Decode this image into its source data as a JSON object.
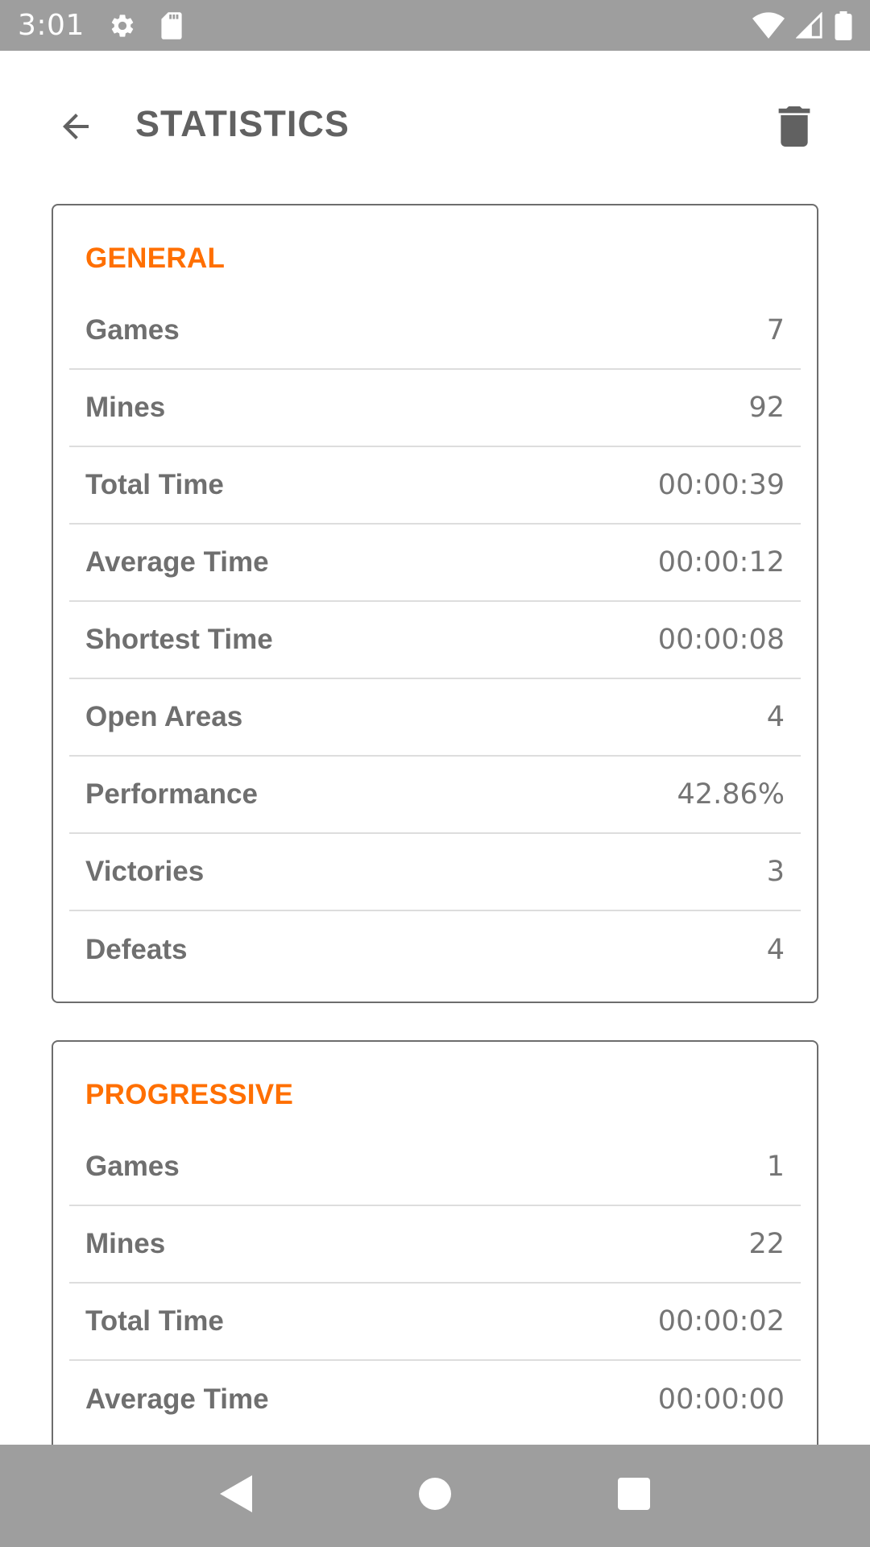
{
  "status_bar": {
    "time": "3:01",
    "icons": [
      "settings-icon",
      "sd-card-icon",
      "wifi-icon",
      "signal-icon",
      "battery-icon"
    ]
  },
  "app_bar": {
    "title": "STATISTICS",
    "back_icon": "arrow-back-icon",
    "delete_icon": "trash-icon"
  },
  "colors": {
    "accent": "#ff6f00",
    "status_bar": "#9e9e9e",
    "text": "#6f6f6f"
  },
  "sections": {
    "general": {
      "title": "GENERAL",
      "rows": [
        {
          "label": "Games",
          "value": "7"
        },
        {
          "label": "Mines",
          "value": "92"
        },
        {
          "label": "Total Time",
          "value": "00:00:39"
        },
        {
          "label": "Average Time",
          "value": "00:00:12"
        },
        {
          "label": "Shortest Time",
          "value": "00:00:08"
        },
        {
          "label": "Open Areas",
          "value": "4"
        },
        {
          "label": "Performance",
          "value": "42.86%"
        },
        {
          "label": "Victories",
          "value": "3"
        },
        {
          "label": "Defeats",
          "value": "4"
        }
      ]
    },
    "progressive": {
      "title": "PROGRESSIVE",
      "rows": [
        {
          "label": "Games",
          "value": "1"
        },
        {
          "label": "Mines",
          "value": "22"
        },
        {
          "label": "Total Time",
          "value": "00:00:02"
        },
        {
          "label": "Average Time",
          "value": "00:00:00"
        }
      ]
    }
  },
  "nav_bar": {
    "icons": [
      "back-triangle-icon",
      "home-circle-icon",
      "recents-square-icon"
    ]
  }
}
